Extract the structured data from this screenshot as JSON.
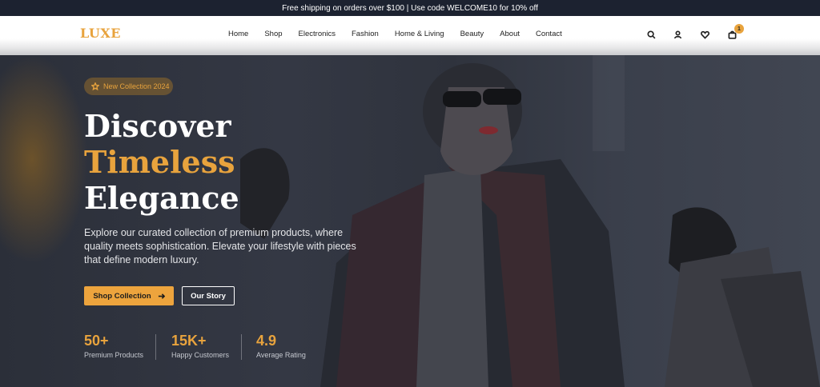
{
  "announcement": "Free shipping on orders over $100 | Use code WELCOME10 for 10% off",
  "brand": {
    "logo": "LUXE",
    "accent": "#e8a33d"
  },
  "nav": {
    "items": [
      "Home",
      "Shop",
      "Electronics",
      "Fashion",
      "Home & Living",
      "Beauty",
      "About",
      "Contact"
    ],
    "cart_count": "1",
    "icons": [
      "search-icon",
      "user-icon",
      "heart-icon",
      "cart-icon"
    ]
  },
  "hero": {
    "badge": "New Collection 2024",
    "headline": {
      "line1": "Discover",
      "line2": "Timeless",
      "line3": "Elegance"
    },
    "description": "Explore our curated collection of premium products, where quality meets sophistication. Elevate your lifestyle with pieces that define modern luxury.",
    "primary_button": "Shop Collection",
    "secondary_button": "Our Story",
    "stats": [
      {
        "value": "50+",
        "label": "Premium Products"
      },
      {
        "value": "15K+",
        "label": "Happy Customers"
      },
      {
        "value": "4.9",
        "label": "Average Rating"
      }
    ]
  }
}
